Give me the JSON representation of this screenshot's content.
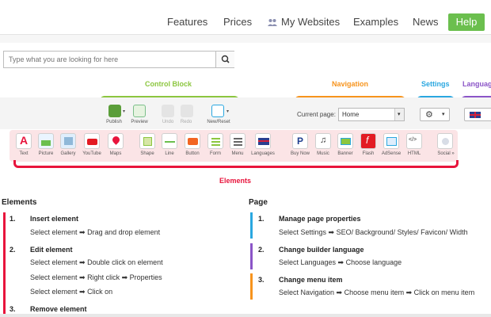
{
  "nav": {
    "features": "Features",
    "prices": "Prices",
    "my_websites": "My Websites",
    "examples": "Examples",
    "news": "News",
    "help": "Help",
    "help_color": "#6bbf4e"
  },
  "search": {
    "placeholder": "Type what you are looking for here"
  },
  "sections": {
    "control_block": {
      "label": "Control Block",
      "color": "#8cc63f"
    },
    "navigation": {
      "label": "Navigation",
      "color": "#f7941d"
    },
    "settings": {
      "label": "Settings",
      "color": "#2aa7e0"
    },
    "language": {
      "label": "Language",
      "color": "#8b55c7"
    },
    "elements": {
      "label": "Elements",
      "color": "#e8143c"
    }
  },
  "control_buttons": [
    "Publish",
    "Preview",
    "Undo",
    "Redo",
    "New/Reset"
  ],
  "navigation": {
    "current_page_label": "Current page:",
    "current_page_value": "Home"
  },
  "element_buttons": [
    "Text",
    "Picture",
    "Gallery",
    "YouTube",
    "Maps",
    "Shape",
    "Line",
    "Button",
    "Form",
    "Menu",
    "Languages",
    "Buy Now",
    "Music",
    "Banner",
    "Flash",
    "AdSense",
    "HTML",
    "Social »"
  ],
  "elements_col": {
    "title": "Elements",
    "steps": [
      {
        "num": "1.",
        "title": "Insert element",
        "lines": [
          "Select element ➡ Drag and drop element"
        ]
      },
      {
        "num": "2.",
        "title": "Edit element",
        "lines": [
          "Select element ➡ Double click on element",
          "Select element ➡ Right click ➡ Properties",
          "Select element ➡ Click on"
        ]
      },
      {
        "num": "3.",
        "title": "Remove element",
        "lines": []
      }
    ]
  },
  "page_col": {
    "title": "Page",
    "steps": [
      {
        "num": "1.",
        "title": "Manage page properties",
        "lines": [
          "Select Settings ➡ SEO/ Background/ Styles/ Favicon/ Width"
        ],
        "color": "#2aa7e0"
      },
      {
        "num": "2.",
        "title": "Change builder language",
        "lines": [
          "Select Languages ➡ Choose language"
        ],
        "color": "#8b55c7"
      },
      {
        "num": "3.",
        "title": "Change menu item",
        "lines": [
          "Select Navigation ➡ Choose menu item ➡ Click on menu item"
        ],
        "color": "#f7941d"
      }
    ]
  }
}
